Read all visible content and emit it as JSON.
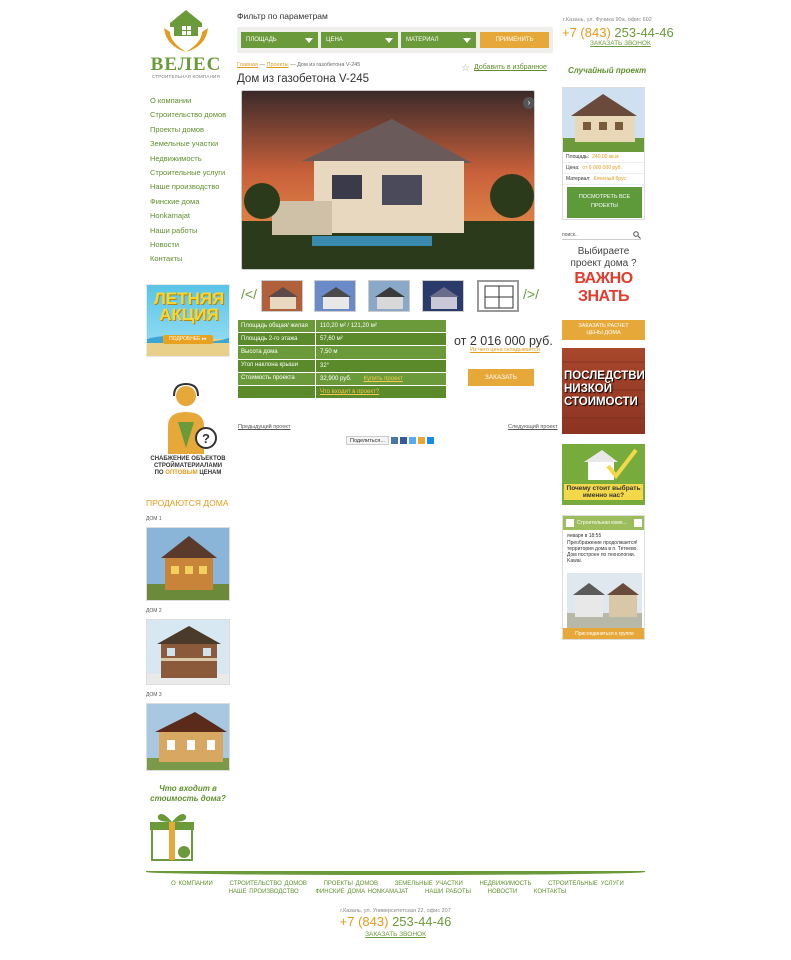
{
  "logo": {
    "name": "ВЕЛЕС",
    "subtitle": "СТРОИТЕЛЬНАЯ КОМПАНИЯ"
  },
  "nav": [
    "О компании",
    "Строительство домов",
    "Проекты домов",
    "Земельные участки",
    "Недвижимость",
    "Строительные услуги",
    "Наше производство",
    "Финские дома",
    "Honkamajat",
    "Наши работы",
    "Новости",
    "Контакты"
  ],
  "promo": {
    "title": "ЛЕТНЯЯ АКЦИЯ",
    "button": "ПОДРОБНЕЕ ▸▸"
  },
  "supply": {
    "line1": "СНАБЖЕНИЕ ОБЪЕКТОВ",
    "line2": "СТРОЙМАТЕРИАЛАМИ",
    "line3_prefix": "ПО",
    "line3_accent": "ОПТОВЫМ",
    "line3_suffix": "ЦЕНАМ"
  },
  "sale": {
    "title": "ПРОДАЮТСЯ ДОМА",
    "items": [
      "ДОМ 1",
      "ДОМ 2",
      "ДОМ 3"
    ]
  },
  "whats_included": "Что входит в стоимость дома?",
  "filter": {
    "title": "Фильтр по параметрам",
    "area": "ПЛОЩАДЬ",
    "price": "ЦЕНА",
    "material": "МАТЕРИАЛ",
    "apply": "ПРИМЕНИТЬ"
  },
  "contacts": {
    "address": "г.Казань, ул. Фучика 90а, офис 602",
    "phone_code": "+7 (843)",
    "phone_number": "253-44-46",
    "callback": "ЗАКАЗАТЬ ЗВОНОК"
  },
  "breadcrumbs": {
    "home": "Главная",
    "sep1": " — ",
    "projects": "Проекты",
    "sep2": " — ",
    "current": "Дом из газобетона V-245"
  },
  "favorite": "Добавить в избранное",
  "page_title": "Дом из газобетона V-245",
  "params": [
    {
      "k": "Площадь общая/ жилая",
      "v": "110,20 м² / 121,20 м²"
    },
    {
      "k": "Площадь 2-го этажа",
      "v": "57,60 м²"
    },
    {
      "k": "Высота дома",
      "v": "7,50 м"
    },
    {
      "k": "Угол наклона крыши",
      "v": "32°"
    },
    {
      "k": "Стоимость проекта",
      "v": "32,900 руб.",
      "link": "Купить проект"
    },
    {
      "k": "",
      "v": "",
      "link": "Что входит в проект?"
    }
  ],
  "price": {
    "value": "от 2 016 000 руб.",
    "link": "Из чего цена складывается"
  },
  "order": "ЗАКАЗАТЬ",
  "pager": {
    "prev": "Предыдущий проект",
    "next": "Следующий проект"
  },
  "share": "Поделиться...",
  "random": {
    "title": "Случайный проект",
    "area_label": "Площадь:",
    "area": "240,00 кв.м",
    "price_label": "Цена:",
    "price": "от 6 000 000 руб.",
    "material_label": "Материал:",
    "material": "Клееный брус",
    "button_line1": "ПОСМОТРЕТЬ ВСЕ",
    "button_line2": "ПРОЕКТЫ"
  },
  "search": {
    "placeholder": "поиск.."
  },
  "important": {
    "q1": "Выбираете",
    "q2": "проект дома ?",
    "big1": "ВАЖНО",
    "big2": "ЗНАТЬ"
  },
  "calc": {
    "line1": "ЗАКАЗАТЬ РАСЧЕТ",
    "line2": "ЦЕНЫ ДОМА"
  },
  "consequences": "ПОСЛЕДСТВИЯ НИЗКОЙ СТОИМОСТИ",
  "why": "Почему стоит выбрать именно нас?",
  "vk": {
    "header": "Строительная комп...",
    "date": "января в 18:55",
    "message": "Преображение продолжается! территория дома в п. Тетеево. Дом построен по технологии. Kawai.",
    "footer": "Присоединиться к группе"
  },
  "footer": {
    "nav": [
      "О КОМПАНИИ",
      "СТРОИТЕЛЬСТВО ДОМОВ",
      "ПРОЕКТЫ ДОМОВ",
      "ЗЕМЕЛЬНЫЕ УЧАСТКИ",
      "НЕДВИЖИМОСТЬ",
      "СТРОИТЕЛЬНЫЕ УСЛУГИ",
      "НАШЕ ПРОИЗВОДСТВО",
      "ФИНСКИЕ ДОМА HONKAMAJAT",
      "НАШИ РАБОТЫ",
      "НОВОСТИ",
      "КОНТАКТЫ"
    ],
    "address": "г.Казань, ул. Университетская 22, офис 207",
    "phone_code": "+7 (843)",
    "phone_number": "253-44-46",
    "callback": "ЗАКАЗАТЬ ЗВОНОК"
  },
  "colors": {
    "green": "#6b9a3a",
    "orange": "#e7a83a",
    "red": "#e33b2e"
  }
}
